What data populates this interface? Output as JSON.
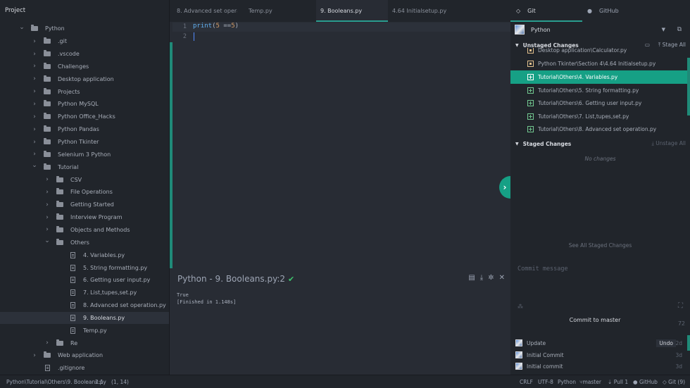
{
  "tree": {
    "header": "Project",
    "items": [
      {
        "label": "Python",
        "depth": 0,
        "kind": "folder",
        "open": true
      },
      {
        "label": ".git",
        "depth": 1,
        "kind": "folder",
        "open": false
      },
      {
        "label": ".vscode",
        "depth": 1,
        "kind": "folder",
        "open": false
      },
      {
        "label": "Challenges",
        "depth": 1,
        "kind": "folder",
        "open": false
      },
      {
        "label": "Desktop application",
        "depth": 1,
        "kind": "folder",
        "open": false
      },
      {
        "label": "Projects",
        "depth": 1,
        "kind": "folder",
        "open": false
      },
      {
        "label": "Python MySQL",
        "depth": 1,
        "kind": "folder",
        "open": false
      },
      {
        "label": "Python Office_Hacks",
        "depth": 1,
        "kind": "folder",
        "open": false
      },
      {
        "label": "Python Pandas",
        "depth": 1,
        "kind": "folder",
        "open": false
      },
      {
        "label": "Python Tkinter",
        "depth": 1,
        "kind": "folder",
        "open": false
      },
      {
        "label": "Selenium 3 Python",
        "depth": 1,
        "kind": "folder",
        "open": false
      },
      {
        "label": "Tutorial",
        "depth": 1,
        "kind": "folder",
        "open": true
      },
      {
        "label": "CSV",
        "depth": 2,
        "kind": "folder",
        "open": false
      },
      {
        "label": "File Operations",
        "depth": 2,
        "kind": "folder",
        "open": false
      },
      {
        "label": "Getting Started",
        "depth": 2,
        "kind": "folder",
        "open": false
      },
      {
        "label": "Interview Program",
        "depth": 2,
        "kind": "folder",
        "open": false
      },
      {
        "label": "Objects and Methods",
        "depth": 2,
        "kind": "folder",
        "open": false
      },
      {
        "label": "Others",
        "depth": 2,
        "kind": "folder",
        "open": true
      },
      {
        "label": "4. Variables.py",
        "depth": 3,
        "kind": "file"
      },
      {
        "label": "5. String formatting.py",
        "depth": 3,
        "kind": "file"
      },
      {
        "label": "6. Getting user input.py",
        "depth": 3,
        "kind": "file"
      },
      {
        "label": "7. List,tupes,set.py",
        "depth": 3,
        "kind": "file"
      },
      {
        "label": "8. Advanced set operation.py",
        "depth": 3,
        "kind": "file"
      },
      {
        "label": "9. Booleans.py",
        "depth": 3,
        "kind": "file",
        "selected": true
      },
      {
        "label": "Temp.py",
        "depth": 3,
        "kind": "file"
      },
      {
        "label": "Re",
        "depth": 2,
        "kind": "folder",
        "open": false
      },
      {
        "label": "Web application",
        "depth": 1,
        "kind": "folder",
        "open": false
      },
      {
        "label": ".gitignore",
        "depth": 1,
        "kind": "file"
      }
    ]
  },
  "tabs": [
    {
      "label": "8. Advanced set operat…",
      "active": false
    },
    {
      "label": "Temp.py",
      "active": false
    },
    {
      "label": "9. Booleans.py",
      "active": true
    },
    {
      "label": "4.64 Initialsetup.py",
      "active": false
    }
  ],
  "editor": {
    "line_numbers": [
      "1",
      "2"
    ],
    "code_fn": "print",
    "code_open": "(",
    "code_num1": "5",
    "code_op": " ==",
    "code_num2": "5",
    "code_close": ")"
  },
  "console": {
    "title": "Python - 9. Booleans.py:2",
    "output": "True\n[Finished in 1.148s]"
  },
  "git": {
    "tab_git": "Git",
    "tab_github": "GitHub",
    "repo": "Python",
    "unstaged_title": "Unstaged Changes",
    "stage_all": "Stage All",
    "unstaged": [
      {
        "path": "Desktop application\\Calculator.py",
        "status": "mod"
      },
      {
        "path": "Python Tkinter\\Section 4\\4.64 Initialsetup.py",
        "status": "mod"
      },
      {
        "path": "Tutorial\\Others\\4. Variables.py",
        "status": "new",
        "selected": true
      },
      {
        "path": "Tutorial\\Others\\5. String formatting.py",
        "status": "new"
      },
      {
        "path": "Tutorial\\Others\\6. Getting user input.py",
        "status": "new"
      },
      {
        "path": "Tutorial\\Others\\7. List,tupes,set.py",
        "status": "new"
      },
      {
        "path": "Tutorial\\Others\\8. Advanced set operation.py",
        "status": "new"
      }
    ],
    "staged_title": "Staged Changes",
    "unstage_all": "Unstage All",
    "no_changes": "No changes",
    "see_all_staged": "See All Staged Changes",
    "commit_placeholder": "Commit message",
    "commit_button": "Commit to master",
    "commit_remaining": "72",
    "undo": "Undo",
    "commits": [
      {
        "message": "Update",
        "age": "2d"
      },
      {
        "message": "Initial Commit",
        "age": "3d"
      },
      {
        "message": "Initial commit",
        "age": "3d"
      }
    ]
  },
  "status": {
    "path": "Python\\Tutorial\\Others\\9. Booleans.py",
    "cursor": "2:1",
    "selection": "(1, 14)",
    "line_ending": "CRLF",
    "encoding": "UTF-8",
    "grammar": "Python",
    "branch": "master",
    "pull": "Pull 1",
    "github": "GitHub",
    "git": "Git (9)"
  }
}
